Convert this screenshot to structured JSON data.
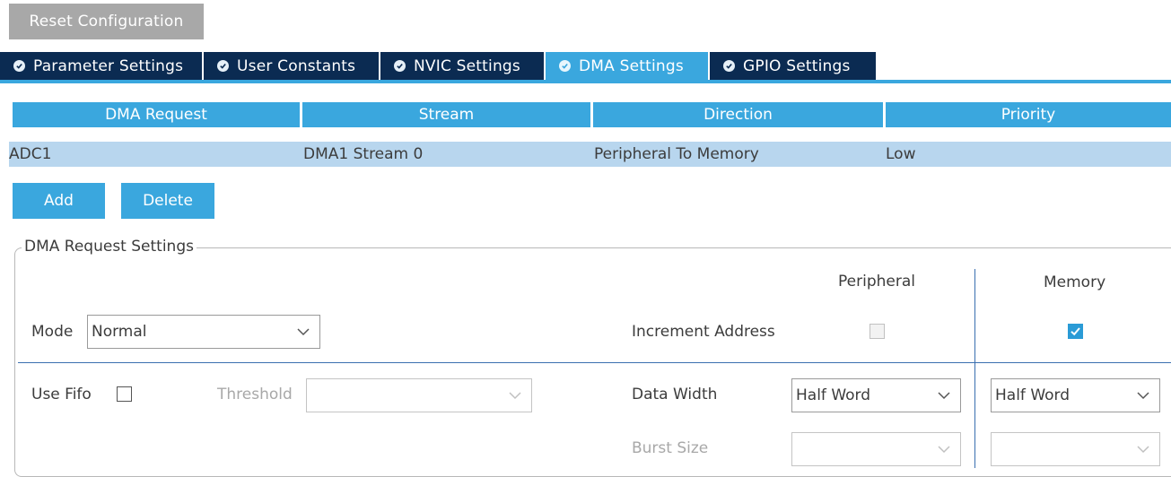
{
  "toolbar": {
    "reset_label": "Reset Configuration"
  },
  "tabs": [
    {
      "label": "Parameter Settings",
      "active": false
    },
    {
      "label": "User Constants",
      "active": false
    },
    {
      "label": "NVIC Settings",
      "active": false
    },
    {
      "label": "DMA Settings",
      "active": true
    },
    {
      "label": "GPIO Settings",
      "active": false
    }
  ],
  "dma_table": {
    "columns": [
      "DMA Request",
      "Stream",
      "Direction",
      "Priority"
    ],
    "rows": [
      {
        "request": "ADC1",
        "stream": "DMA1 Stream 0",
        "direction": "Peripheral To Memory",
        "priority": "Low"
      }
    ]
  },
  "actions": {
    "add_label": "Add",
    "delete_label": "Delete"
  },
  "settings": {
    "legend": "DMA Request Settings",
    "peripheral_header": "Peripheral",
    "memory_header": "Memory",
    "mode_label": "Mode",
    "mode_value": "Normal",
    "increment_address_label": "Increment Address",
    "peripheral_increment": false,
    "memory_increment": true,
    "use_fifo_label": "Use Fifo",
    "use_fifo": false,
    "threshold_label": "Threshold",
    "threshold_value": "",
    "data_width_label": "Data Width",
    "peripheral_data_width": "Half Word",
    "memory_data_width": "Half Word",
    "burst_size_label": "Burst Size",
    "peripheral_burst_size": "",
    "memory_burst_size": ""
  },
  "colors": {
    "tab_dark": "#0b2b52",
    "tab_active": "#3aa7de",
    "row_selected": "#b8d6ee",
    "button_gray": "#a8a8a8",
    "checkbox_checked": "#2a9bd6"
  }
}
